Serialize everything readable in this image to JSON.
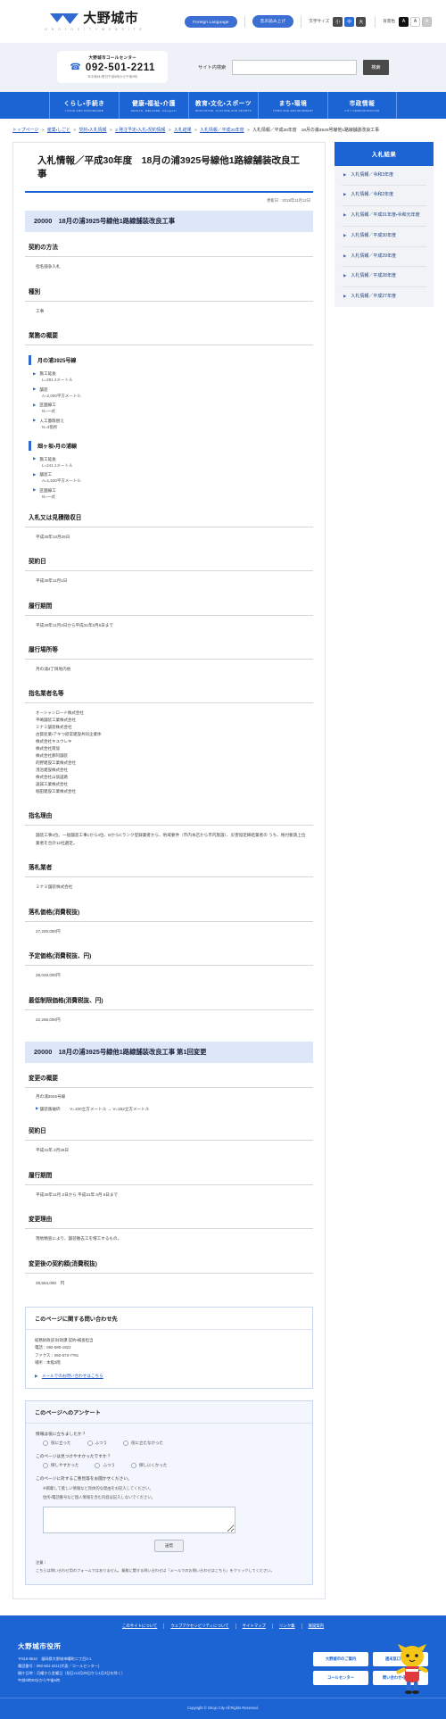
{
  "header": {
    "logo_jp": "大野城市",
    "logo_en": "O N O J O   C I T Y   W E B S I T E",
    "foreign_language": "Foreign Language",
    "voice_read": "音声読み上げ",
    "font_size_label": "文字サイズ",
    "font_small": "小",
    "font_medium": "中",
    "font_large": "大",
    "bgcolor_label": "背景色",
    "bg_black": "A",
    "bg_white": "A",
    "bg_gray": "A"
  },
  "callcenter": {
    "title": "大野城市コールセンター",
    "phone": "092-501-2211",
    "hours": "年中無休・受付午前8時から午後9時"
  },
  "search": {
    "label": "サイト内検索",
    "placeholder": "",
    "value": "",
    "button": "検索"
  },
  "gnav": [
    {
      "jp": "くらし・手続き",
      "en": "LIVING AND PROCEDURE"
    },
    {
      "jp": "健康・福祉・介護",
      "en": "HEALTH, WELFARE, Caregiver"
    },
    {
      "jp": "教育・文化・スポーツ",
      "en": "EDUCATION, CULTURE AND SPORTS"
    },
    {
      "jp": "まち・環境",
      "en": "TOWN AND ENVIRONMENT"
    },
    {
      "jp": "市政情報",
      "en": "CITY ADMINISTRATION"
    }
  ],
  "breadcrumb": {
    "items": [
      "トップページ",
      "産業・しごと",
      "契約・入札情報",
      "2.発注予定・入札・契約情報",
      "入札結果",
      "入札情報／平成30年度"
    ],
    "current": "入札情報／平成30年度　18月の浦3925号線他1路線舗装改良工事",
    "separator": ">"
  },
  "page": {
    "title": "入札情報／平成30年度　18月の浦3925号線他1路線舗装改良工事",
    "updated": "更新日：2018年11月12日"
  },
  "section1": {
    "bar": "20000　18月の浦3925号線他1路線舗装改良工事",
    "contract_method_head": "契約の方法",
    "contract_method_value": "指名競争入札",
    "type_head": "種別",
    "type_value": "工事",
    "summary_head": "業務の概要",
    "works": [
      {
        "name": "月の浦3925号線",
        "specs": [
          {
            "term": "施工延長",
            "value": "L=291.4メートル"
          },
          {
            "term": "舗装",
            "value": "A=2,000平方メートル"
          },
          {
            "term": "区画線工",
            "value": "N=一式"
          },
          {
            "term": "人工蓋取替え",
            "value": "N=3箇所"
          }
        ]
      },
      {
        "name": "畑ヶ坂・月の浦線",
        "specs": [
          {
            "term": "施工延長",
            "value": "L=241.1メートル"
          },
          {
            "term": "舗装工",
            "value": "A=1,530平方メートル"
          },
          {
            "term": "区画線工",
            "value": "N=一式"
          }
        ]
      }
    ],
    "bid_date_head": "入札又は見積徴収日",
    "bid_date_value": "平成30年10月25日",
    "contract_date_head": "契約日",
    "contract_date_value": "平成30年11月1日",
    "period_head": "履行期間",
    "period_value": "平成30年11月2日から平成31年3月6日まで",
    "place_head": "履行場所等",
    "place_value": "月の浦4丁目地内他",
    "nominees_head": "指名業者名等",
    "nominees": [
      "オーシャンロード株式会社",
      "平嶋舗装工業株式会社",
      "ミナミ舗装株式会社",
      "古賀産業・アキつ経常建設共同企業体",
      "株式会社キユウレキ",
      "株式会社南協",
      "株式会社那阿舗装",
      "的野建設工業株式会社",
      "浅治建設株式会社",
      "株式会社山協道路",
      "遠誠工業株式会社",
      "堀田建設工業株式会社"
    ],
    "reason_head": "指名理由",
    "reason_value": "舗装工事1位、一般舗装工事1から4位、BからCランク登録業者から、地域要件（市内本店から市内施設）、災害協定締結業者の うち、格付要請上位業者を合計12社選定。",
    "winner_head": "落札業者",
    "winner_value": "ミナミ舗装株式会社",
    "price_head": "落札価格(消費税抜)",
    "price_value": "27,200,000円",
    "estimate_head": "予定価格(消費税抜、円)",
    "estimate_value": "28,049,000円",
    "lowest_head": "最低制限価格(消費税抜、円)",
    "lowest_value": "22,266,000円"
  },
  "section2": {
    "bar": "20000　18月の浦3925号線他1路線舗装改良工事 第1回変更",
    "change_summary_head": "変更の概要",
    "change_route": "月の浦3925号線",
    "change_spec_term": "舗装版破砕",
    "change_spec_value": "V=100立方メートル → V=152立方メートル",
    "contract_date_head": "契約日",
    "contract_date_value": "平成31年 2月26日",
    "period_head": "履行期間",
    "period_value": "平成30年11月 2日から 平成31年 3月 6日まで",
    "reason_head": "変更理由",
    "reason_value": "現地精査により、舗装撤去工を増工するもの。",
    "amount_head": "変更後の契約額(消費税抜)",
    "amount_value": "28,554,000　円"
  },
  "inquiry": {
    "title": "このページに関する問い合わせ先",
    "dept": "総務財政部 財政課 契約・検査担当",
    "tel": "電話：092-580-1822",
    "fax": "ファクス：092-573-7791",
    "location": "場所：本館3階",
    "mail_link": "メールでのお問い合わせはこちら"
  },
  "survey": {
    "title": "このページへのアンケート",
    "q1": "情報は役に立ちましたか？",
    "q1_options": [
      "役に立った",
      "ふつう",
      "役に立たなかった"
    ],
    "q2": "このページは見つけやすかったですか？",
    "q2_options": [
      "探しやすかった",
      "ふつう",
      "探しにくかった"
    ],
    "q3": "このページに対するご意見等をお聞かせください。",
    "q3_note1": "※掲載して欲しい情報など具体的な理由をお記入してください。",
    "q3_note2": "住所・電話番号など個人情報を含む内容は記入しないでください。",
    "textarea_value": "",
    "submit": "送信",
    "caution_head": "注意：",
    "caution_body": "こちらは問い合わせ用のフォームではありません。業務に関する問い合わせは「メールでのお問い合わせはこちら」をクリックしてください。"
  },
  "footer": {
    "links": [
      "このサイトについて",
      "ウェブアクセシビリティについて",
      "サイトマップ",
      "リンク集",
      "施設案内"
    ],
    "city": "大野城市役所",
    "address": [
      "〒816-8510　福岡県大野城市曙町二丁目2-1",
      "電話番号：092-501-2211(代表／コールセンター)",
      "開庁日時：月曜から金曜日（祝日・12月29日から1月3日を除く）",
      "午前8時30分から午後5時"
    ],
    "buttons": [
      "大野城市のご案内",
      "週末窓口サービス",
      "コールセンター",
      "問い合わせ・窓案内付"
    ],
    "copyright": "Copyright © Onojo City All Rights Reserved."
  },
  "icons": {
    "phone": "phone-icon",
    "triangle": "triangle-bullet-icon",
    "mail": "mail-icon"
  }
}
